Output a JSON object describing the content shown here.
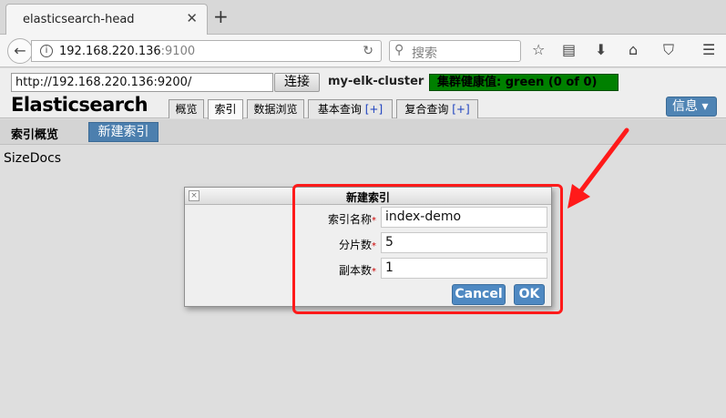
{
  "browser": {
    "tab_title": "elasticsearch-head",
    "tab_close": "✕",
    "new_tab": "+",
    "back": "←",
    "info": "i",
    "url_host": "192.168.220.136",
    "url_port": ":9100",
    "reload": "↻",
    "search_placeholder": "搜索"
  },
  "head": {
    "connection_url": "http://192.168.220.136:9200/",
    "connect_label": "连接",
    "cluster_name": "my-elk-cluster",
    "health_text": "集群健康值: green (0 of 0)",
    "brand": "Elasticsearch",
    "tabs": [
      {
        "label": "概览"
      },
      {
        "label": "索引"
      },
      {
        "label": "数据浏览"
      },
      {
        "label": "基本查询",
        "plus": "[+]"
      },
      {
        "label": "复合查询",
        "plus": "[+]"
      }
    ],
    "info_menu": "信息 ▾",
    "sub_title": "索引概览",
    "new_index_label": "新建索引",
    "size_docs": "SizeDocs"
  },
  "dialog": {
    "title": "新建索引",
    "close": "×",
    "fields": [
      {
        "label": "索引名称",
        "value": "index-demo"
      },
      {
        "label": "分片数",
        "value": "5"
      },
      {
        "label": "副本数",
        "value": "1"
      }
    ],
    "required_mark": "*",
    "cancel_label": "Cancel",
    "ok_label": "OK"
  },
  "colors": {
    "health": "#008000",
    "accent_blue": "#4f89c2",
    "annotation_red": "#ff1a1a"
  }
}
